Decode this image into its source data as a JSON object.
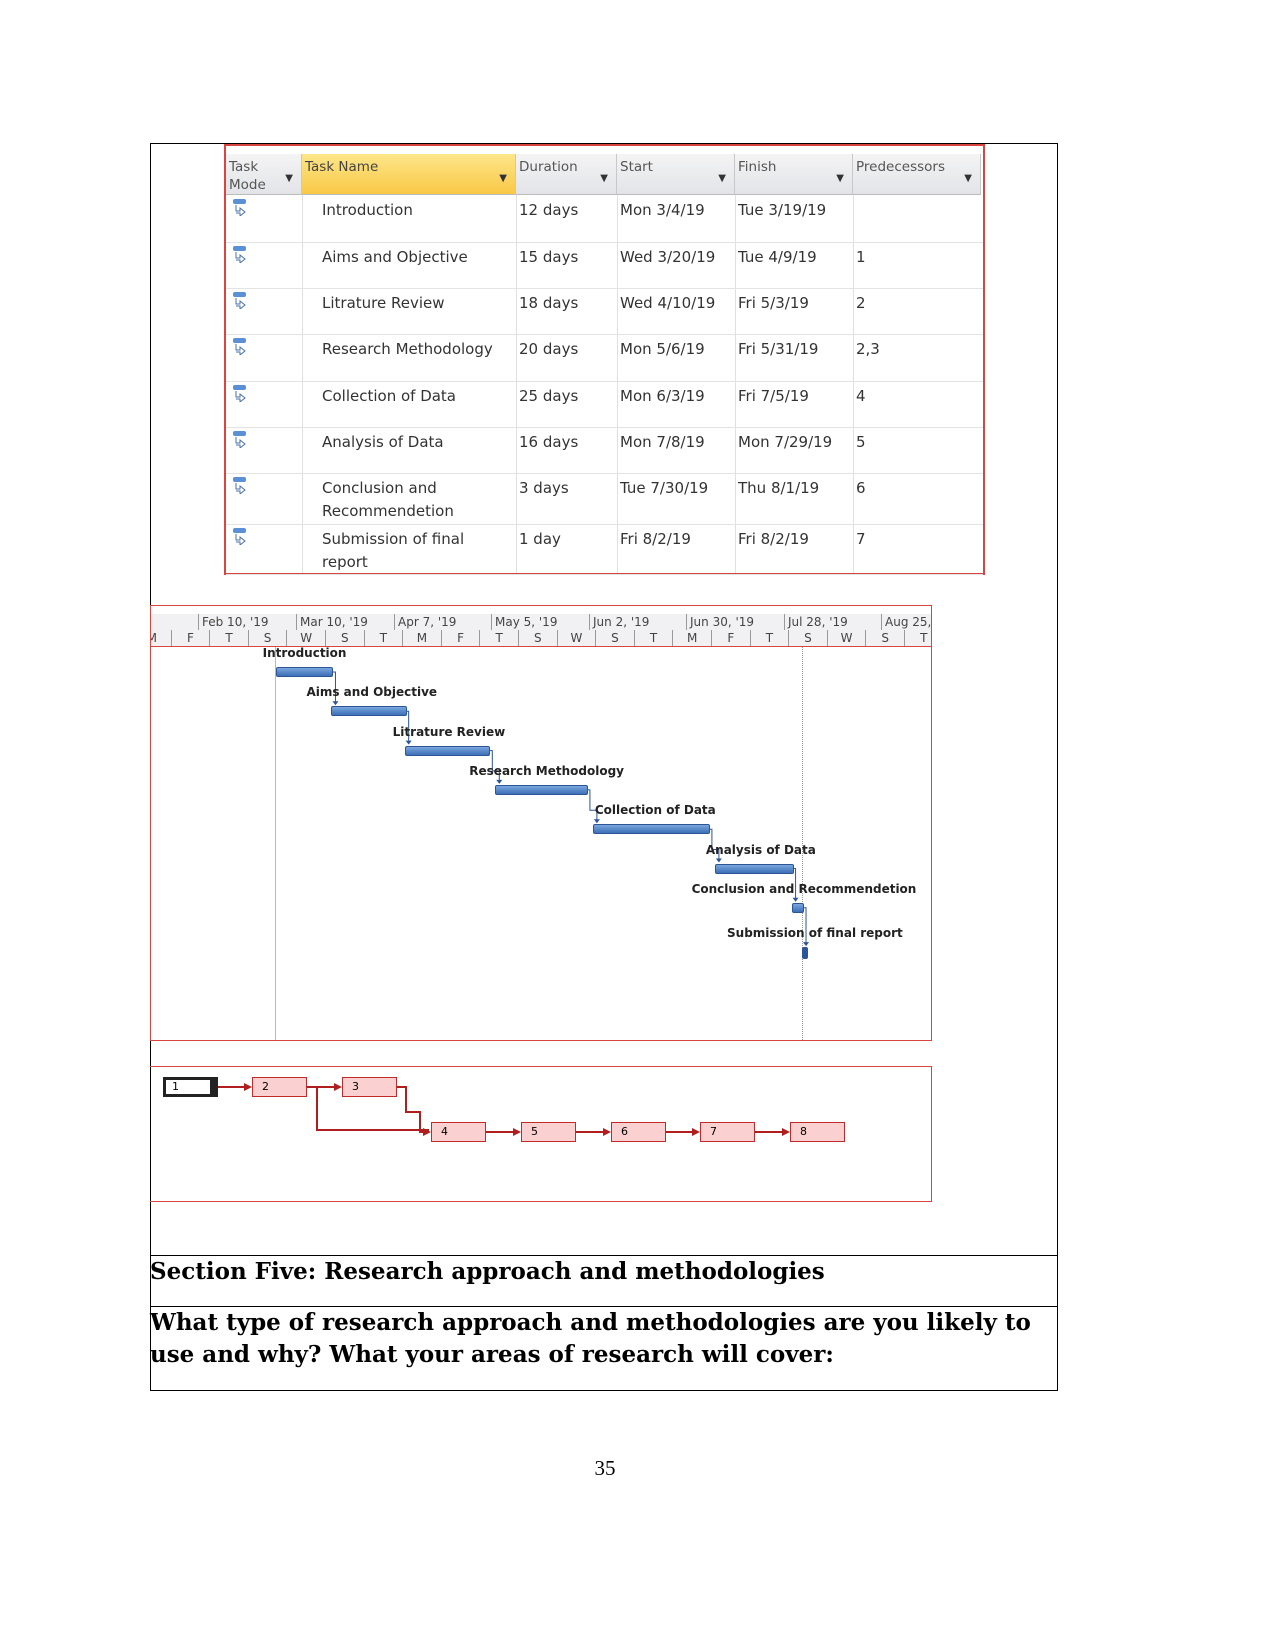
{
  "table": {
    "headers": [
      "Task Mode",
      "Task Name",
      "Duration",
      "Start",
      "Finish",
      "Predecessors"
    ],
    "rows": [
      {
        "name": "Introduction",
        "duration": "12 days",
        "start": "Mon 3/4/19",
        "finish": "Tue 3/19/19",
        "pred": ""
      },
      {
        "name": "Aims and Objective",
        "duration": "15 days",
        "start": "Wed 3/20/19",
        "finish": "Tue 4/9/19",
        "pred": "1"
      },
      {
        "name": "Litrature Review",
        "duration": "18 days",
        "start": "Wed 4/10/19",
        "finish": "Fri 5/3/19",
        "pred": "2"
      },
      {
        "name": "Research Methodology",
        "duration": "20 days",
        "start": "Mon 5/6/19",
        "finish": "Fri 5/31/19",
        "pred": "2,3"
      },
      {
        "name": "Collection of Data",
        "duration": "25 days",
        "start": "Mon 6/3/19",
        "finish": "Fri 7/5/19",
        "pred": "4"
      },
      {
        "name": "Analysis of Data",
        "duration": "16 days",
        "start": "Mon 7/8/19",
        "finish": "Mon 7/29/19",
        "pred": "5"
      },
      {
        "name": "Conclusion and Recommendetion",
        "duration": "3 days",
        "start": "Tue 7/30/19",
        "finish": "Thu 8/1/19",
        "pred": "6"
      },
      {
        "name": "Submission of final report",
        "duration": "1 day",
        "start": "Fri 8/2/19",
        "finish": "Fri 8/2/19",
        "pred": "7"
      }
    ]
  },
  "gantt": {
    "weeks": [
      "'19",
      "Feb 10, '19",
      "Mar 10, '19",
      "Apr 7, '19",
      "May 5, '19",
      "Jun 2, '19",
      "Jun 30, '19",
      "Jul 28, '19",
      "Aug 25,"
    ],
    "days": [
      "M",
      "F",
      "T",
      "S",
      "W",
      "S",
      "T",
      "M",
      "F",
      "T",
      "S",
      "W",
      "S",
      "T",
      "M",
      "F",
      "T",
      "S",
      "W",
      "S",
      "T"
    ],
    "bars": [
      {
        "label": "Introduction",
        "start": "2019-03-04",
        "end": "2019-03-19"
      },
      {
        "label": "Aims and Objective",
        "start": "2019-03-20",
        "end": "2019-04-09"
      },
      {
        "label": "Litrature Review",
        "start": "2019-04-10",
        "end": "2019-05-03"
      },
      {
        "label": "Research Methodology",
        "start": "2019-05-06",
        "end": "2019-05-31"
      },
      {
        "label": "Collection of Data",
        "start": "2019-06-03",
        "end": "2019-07-05"
      },
      {
        "label": "Analysis of Data",
        "start": "2019-07-08",
        "end": "2019-07-29"
      },
      {
        "label": "Conclusion and Recommendetion",
        "start": "2019-07-30",
        "end": "2019-08-01"
      },
      {
        "label": "Submission of final report",
        "start": "2019-08-02",
        "end": "2019-08-02"
      }
    ],
    "bar_color": "#3d6fb8"
  },
  "network": {
    "nodes": [
      "1",
      "2",
      "3",
      "4",
      "5",
      "6",
      "7",
      "8"
    ],
    "link_color": "#b01e1e"
  },
  "section_title": "Section Five: Research approach and methodologies",
  "question": "What type of research approach and methodologies are you likely to use and why? What your areas of research will cover:",
  "page_number": "35"
}
